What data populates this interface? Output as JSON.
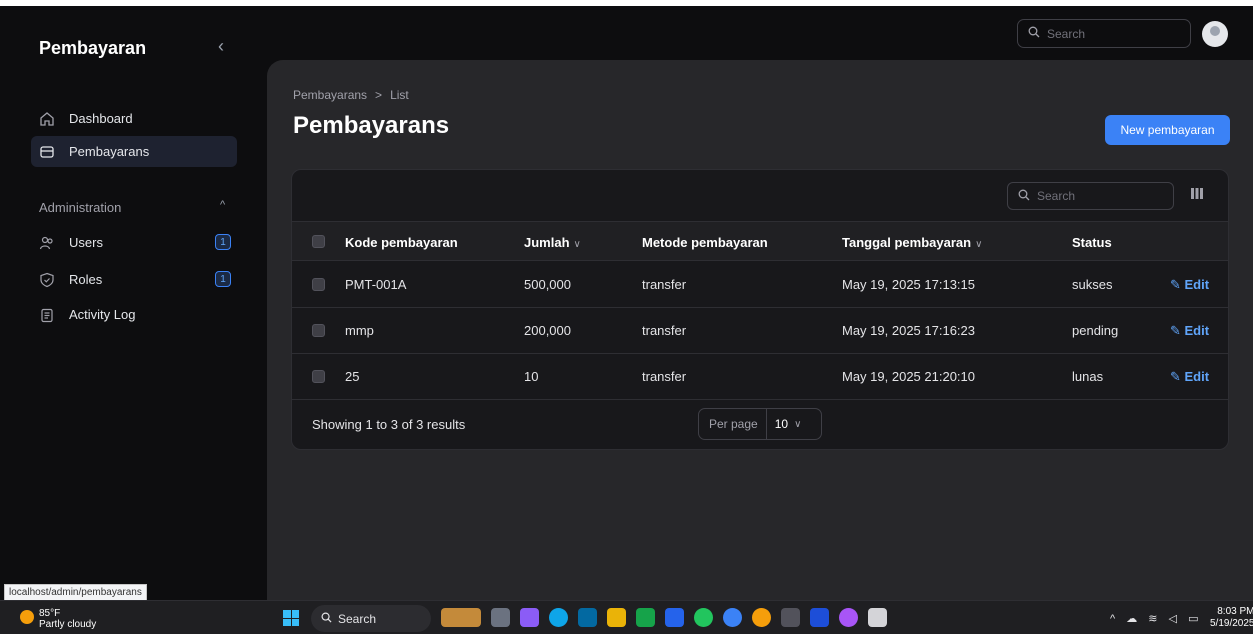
{
  "sidebar": {
    "brand": "Pembayaran",
    "items": [
      {
        "label": "Dashboard",
        "icon": "home-icon"
      },
      {
        "label": "Pembayarans",
        "icon": "card-icon",
        "active": true
      }
    ],
    "group": {
      "label": "Administration",
      "items": [
        {
          "label": "Users",
          "icon": "users-icon",
          "badge": "1"
        },
        {
          "label": "Roles",
          "icon": "shield-icon",
          "badge": "1"
        },
        {
          "label": "Activity Log",
          "icon": "clipboard-icon"
        }
      ]
    }
  },
  "topbar": {
    "search_placeholder": "Search"
  },
  "page": {
    "breadcrumb": [
      "Pembayarans",
      ">",
      "List"
    ],
    "title": "Pembayarans",
    "new_button": "New pembayaran"
  },
  "table": {
    "search_placeholder": "Search",
    "columns": [
      "Kode pembayaran",
      "Jumlah",
      "Metode pembayaran",
      "Tanggal pembayaran",
      "Status"
    ],
    "rows": [
      {
        "kode": "PMT-001A",
        "jumlah": "500,000",
        "metode": "transfer",
        "tanggal": "May 19, 2025 17:13:15",
        "status": "sukses",
        "action": "Edit"
      },
      {
        "kode": "mmp",
        "jumlah": "200,000",
        "metode": "transfer",
        "tanggal": "May 19, 2025 17:16:23",
        "status": "pending",
        "action": "Edit"
      },
      {
        "kode": "25",
        "jumlah": "10",
        "metode": "transfer",
        "tanggal": "May 19, 2025 21:20:10",
        "status": "lunas",
        "action": "Edit"
      }
    ],
    "showing": "Showing 1 to 3 of 3 results",
    "per_page_label": "Per page",
    "per_page_value": "10"
  },
  "statusbar": {
    "url": "localhost/admin/pembayarans"
  },
  "taskbar": {
    "temp": "85°F",
    "weather": "Partly cloudy",
    "search": "Search",
    "time": "8:03 PM",
    "date": "5/19/2025"
  },
  "colors": {
    "accent": "#3b82f6",
    "background": "#0d0d0f",
    "panel": "#27272a"
  }
}
